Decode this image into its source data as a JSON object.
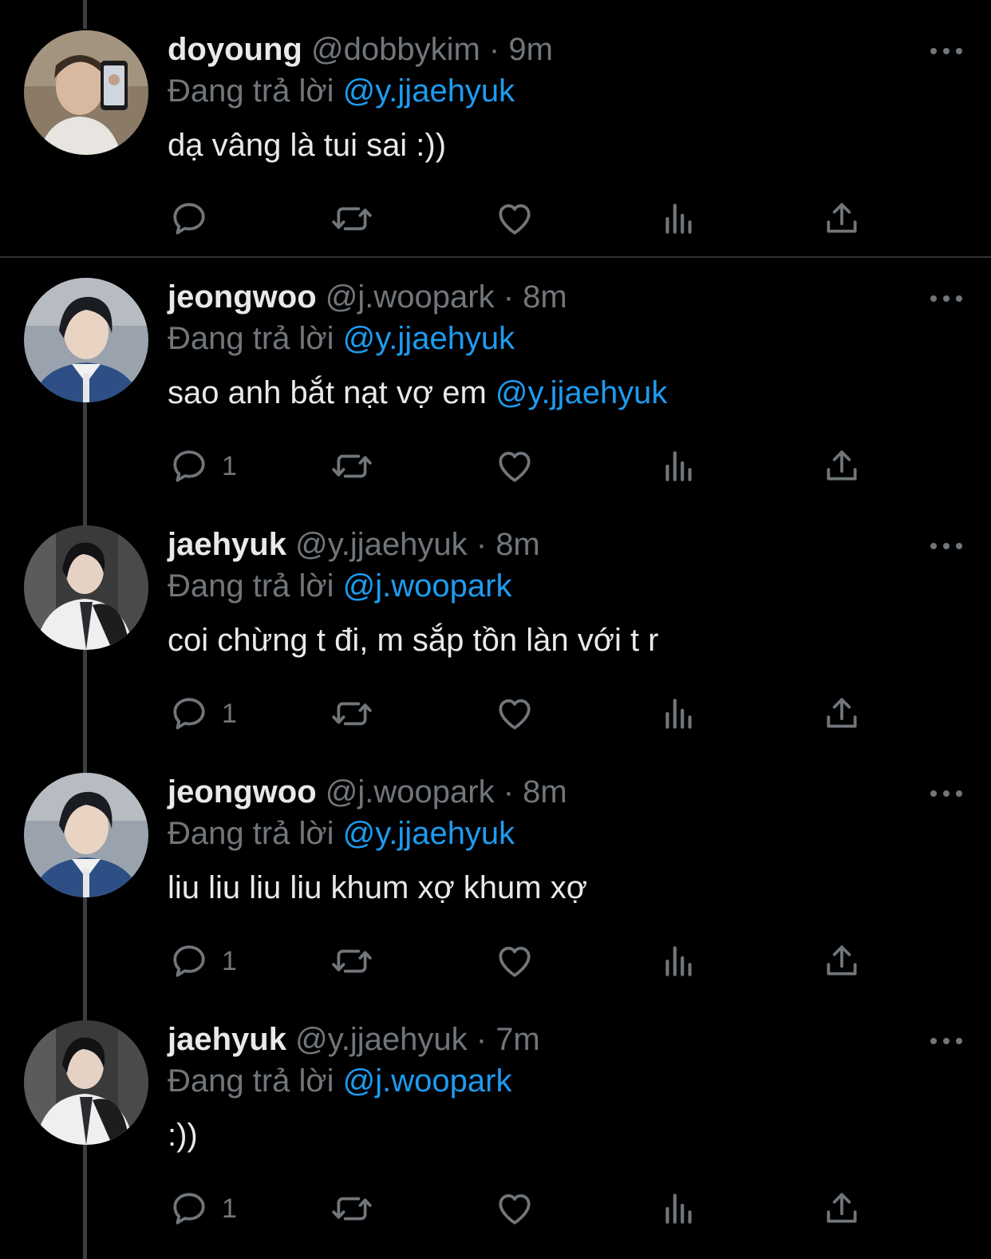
{
  "colors": {
    "background": "#000000",
    "text_primary": "#e7e9ea",
    "text_secondary": "#71767b",
    "mention": "#1d9bf0",
    "thread_line": "#3a3d42"
  },
  "tweets": [
    {
      "display_name": "doyoung",
      "handle": "@dobbykim",
      "separator": "·",
      "time": "9m",
      "reply_prefix": "Đang trả lời",
      "reply_to": "@y.jjaehyuk",
      "body_text": "dạ vâng là tui sai :))",
      "body_mention": "",
      "reply_count": "",
      "avatar_icon": "avatar-doyoung"
    },
    {
      "display_name": "jeongwoo",
      "handle": "@j.woopark",
      "separator": "·",
      "time": "8m",
      "reply_prefix": "Đang trả lời",
      "reply_to": "@y.jjaehyuk",
      "body_text": "sao anh bắt nạt vợ em ",
      "body_mention": "@y.jjaehyuk",
      "reply_count": "1",
      "avatar_icon": "avatar-jeongwoo"
    },
    {
      "display_name": "jaehyuk",
      "handle": "@y.jjaehyuk",
      "separator": "·",
      "time": "8m",
      "reply_prefix": "Đang trả lời",
      "reply_to": "@j.woopark",
      "body_text": "coi chừng t đi, m sắp tồn làn với t r",
      "body_mention": "",
      "reply_count": "1",
      "avatar_icon": "avatar-jaehyuk"
    },
    {
      "display_name": "jeongwoo",
      "handle": "@j.woopark",
      "separator": "·",
      "time": "8m",
      "reply_prefix": "Đang trả lời",
      "reply_to": "@y.jjaehyuk",
      "body_text": "liu liu liu liu khum xợ khum xợ",
      "body_mention": "",
      "reply_count": "1",
      "avatar_icon": "avatar-jeongwoo"
    },
    {
      "display_name": "jaehyuk",
      "handle": "@y.jjaehyuk",
      "separator": "·",
      "time": "7m",
      "reply_prefix": "Đang trả lời",
      "reply_to": "@j.woopark",
      "body_text": ":))",
      "body_mention": "",
      "reply_count": "1",
      "avatar_icon": "avatar-jaehyuk"
    }
  ],
  "action_icons": [
    "reply-icon",
    "retweet-icon",
    "like-icon",
    "views-icon",
    "share-icon"
  ]
}
